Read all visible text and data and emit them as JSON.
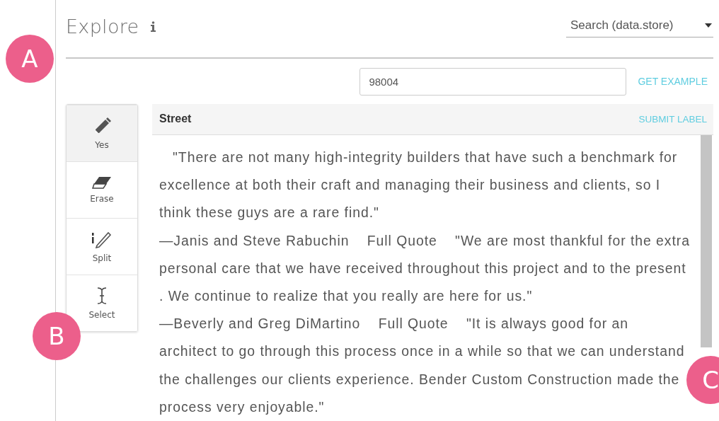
{
  "header": {
    "title": "Explore",
    "source_dropdown": {
      "value": "Search (data.store)"
    }
  },
  "example": {
    "value": "98004",
    "button": "GET EXAMPLE"
  },
  "tools": [
    {
      "label": "Yes",
      "kind": "pencil",
      "selected": true
    },
    {
      "label": "Erase",
      "kind": "eraser",
      "selected": false
    },
    {
      "label": "Split",
      "kind": "split",
      "selected": false
    },
    {
      "label": "Select",
      "kind": "cursor",
      "selected": false
    }
  ],
  "panel": {
    "label": "Street",
    "action": "SUBMIT LABEL",
    "paragraphs": [
      "   \"There are not many high-integrity builders that have such a benchmark for excellence at both their craft and managing their business and clients, so I think these guys are a rare find.\"",
      "—Janis and Steve Rabuchin    Full Quote    \"We are most thankful for the extra personal care that we have received throughout this project and to the present . We continue to realize that you really are here for us.\"",
      "—Beverly and Greg DiMartino    Full Quote    \"It is always good for an architect to go through this process once in a while so that we can understand the challenges our clients experience. Bender Custom Construction made the process very enjoyable.\""
    ]
  },
  "callouts": [
    "A",
    "B",
    "C"
  ]
}
